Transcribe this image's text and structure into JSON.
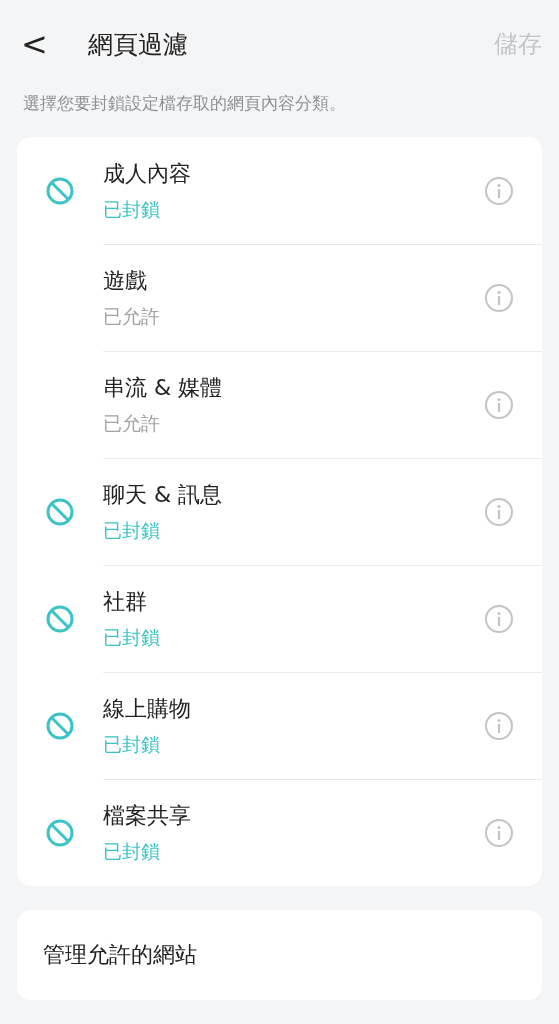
{
  "header": {
    "back": "<",
    "title": "網頁過濾",
    "save": {
      "label": "儲存",
      "disabled": true
    }
  },
  "subtitle": "選擇您要封鎖設定檔存取的網頁內容分類。",
  "categories": [
    {
      "name": "成人內容",
      "status": "已封鎖",
      "blocked": true
    },
    {
      "name": "遊戲",
      "status": "已允許",
      "blocked": false
    },
    {
      "name": "串流 & 媒體",
      "status": "已允許",
      "blocked": false
    },
    {
      "name": "聊天 & 訊息",
      "status": "已封鎖",
      "blocked": true
    },
    {
      "name": "社群",
      "status": "已封鎖",
      "blocked": true
    },
    {
      "name": "線上購物",
      "status": "已封鎖",
      "blocked": true
    },
    {
      "name": "檔案共享",
      "status": "已封鎖",
      "blocked": true
    }
  ],
  "manage_link": "管理允許的網站"
}
